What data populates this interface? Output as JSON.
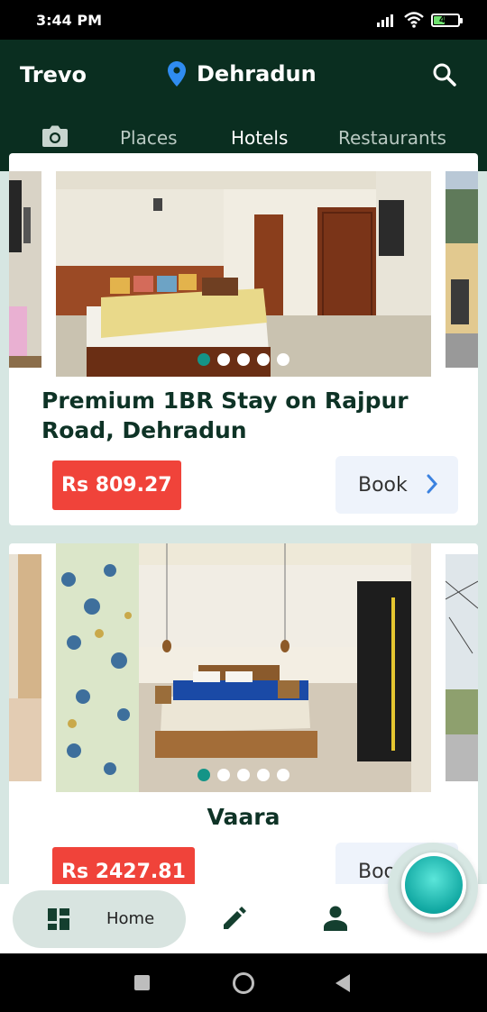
{
  "status_bar": {
    "time": "3:44 PM",
    "battery": "42"
  },
  "app_bar": {
    "title": "Trevo",
    "location": "Dehradun",
    "tabs": [
      {
        "label": "Places",
        "active": false
      },
      {
        "label": "Hotels",
        "active": true
      },
      {
        "label": "Restaurants",
        "active": false
      }
    ]
  },
  "hotels": [
    {
      "name": "Premium 1BR Stay on Rajpur Road, Dehradun",
      "price": "Rs 809.27",
      "book_label": "Book",
      "image_count": 5,
      "active_image": 1
    },
    {
      "name": "Vaara",
      "price": "Rs 2427.81",
      "book_label": "Book",
      "image_count": 5,
      "active_image": 1
    }
  ],
  "bottom_nav": {
    "home_label": "Home"
  },
  "icons": [
    "location-pin-icon",
    "search-icon",
    "camera-icon",
    "chevron-right-icon",
    "dashboard-icon",
    "edit-icon",
    "person-icon"
  ],
  "colors": {
    "app_bar": "#0a2e20",
    "price_tag": "#f0433a",
    "accent": "#149487"
  }
}
